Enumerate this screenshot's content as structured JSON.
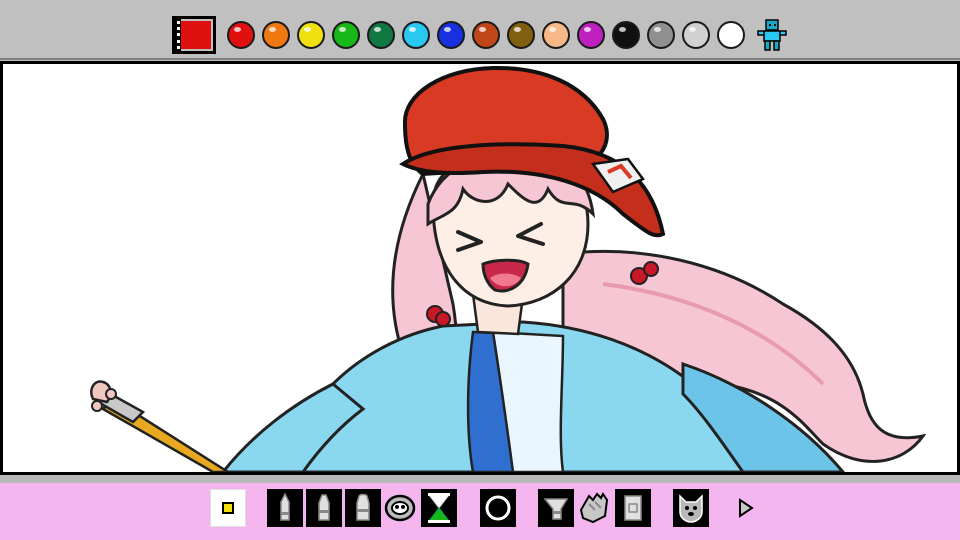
{
  "palette": {
    "current_color": "#e01010",
    "colors": [
      {
        "name": "red",
        "hex": "#e01010"
      },
      {
        "name": "orange",
        "hex": "#f07810"
      },
      {
        "name": "yellow",
        "hex": "#f0e010"
      },
      {
        "name": "green",
        "hex": "#18b818"
      },
      {
        "name": "dark-green",
        "hex": "#107840"
      },
      {
        "name": "cyan",
        "hex": "#28c8f0"
      },
      {
        "name": "blue",
        "hex": "#1830e0"
      },
      {
        "name": "brown-red",
        "hex": "#c04818"
      },
      {
        "name": "olive-brown",
        "hex": "#806010"
      },
      {
        "name": "peach",
        "hex": "#f8b888"
      },
      {
        "name": "magenta",
        "hex": "#c020c0"
      },
      {
        "name": "black",
        "hex": "#101010"
      },
      {
        "name": "gray",
        "hex": "#909090"
      },
      {
        "name": "light-gray",
        "hex": "#d0d0d0"
      },
      {
        "name": "white",
        "hex": "#ffffff"
      }
    ],
    "mascot_icon": "robot-mascot-icon"
  },
  "toolbar": {
    "background": "#f5b6f0",
    "tools": [
      {
        "name": "brush-size-tool",
        "icon": "small-square-icon"
      },
      {
        "name": "pencil-tool",
        "icon": "pencil-icon"
      },
      {
        "name": "marker-tool",
        "icon": "marker-icon"
      },
      {
        "name": "crayon-tool",
        "icon": "crayon-icon"
      },
      {
        "name": "spray-tool",
        "icon": "spray-can-icon"
      },
      {
        "name": "undo-tool",
        "icon": "hourglass-icon"
      },
      {
        "name": "stamp-tool",
        "icon": "circle-stamp-icon"
      },
      {
        "name": "paint-bucket-tool",
        "icon": "paint-bucket-icon"
      },
      {
        "name": "eraser-hand-tool",
        "icon": "eraser-hand-icon"
      },
      {
        "name": "eraser-tool",
        "icon": "eraser-icon"
      },
      {
        "name": "dog-tool",
        "icon": "dog-face-icon"
      },
      {
        "name": "next-page-button",
        "icon": "arrow-right-icon"
      }
    ]
  }
}
